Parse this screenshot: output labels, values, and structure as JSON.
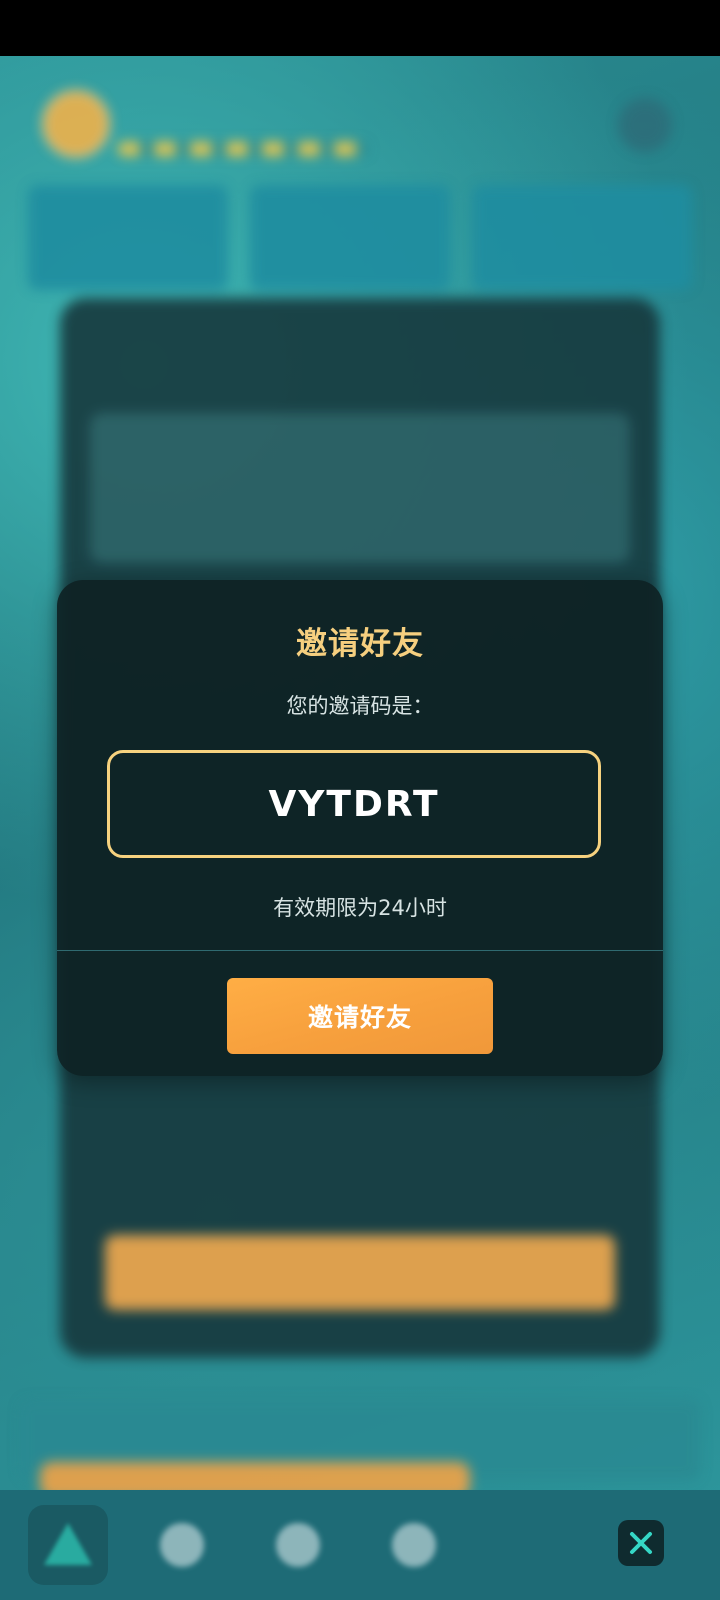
{
  "modal": {
    "title": "邀请好友",
    "subtitle": "您的邀请码是：",
    "invite_code": "VYTDRT",
    "validity": "有效期限为24小时",
    "invite_button_label": "邀请好友"
  },
  "bottom_nav": {
    "items": [
      {
        "icon": "triangle-home-icon",
        "active": true
      },
      {
        "icon": "trophy-icon",
        "active": false
      },
      {
        "icon": "compass-icon",
        "active": false
      },
      {
        "icon": "heart-icon",
        "active": false
      }
    ],
    "close_icon": "close-icon"
  },
  "colors": {
    "accent": "#f6cf7f",
    "button": "#f7a03d",
    "modal_bg": "#0e2224",
    "background": "#2a8c92"
  }
}
